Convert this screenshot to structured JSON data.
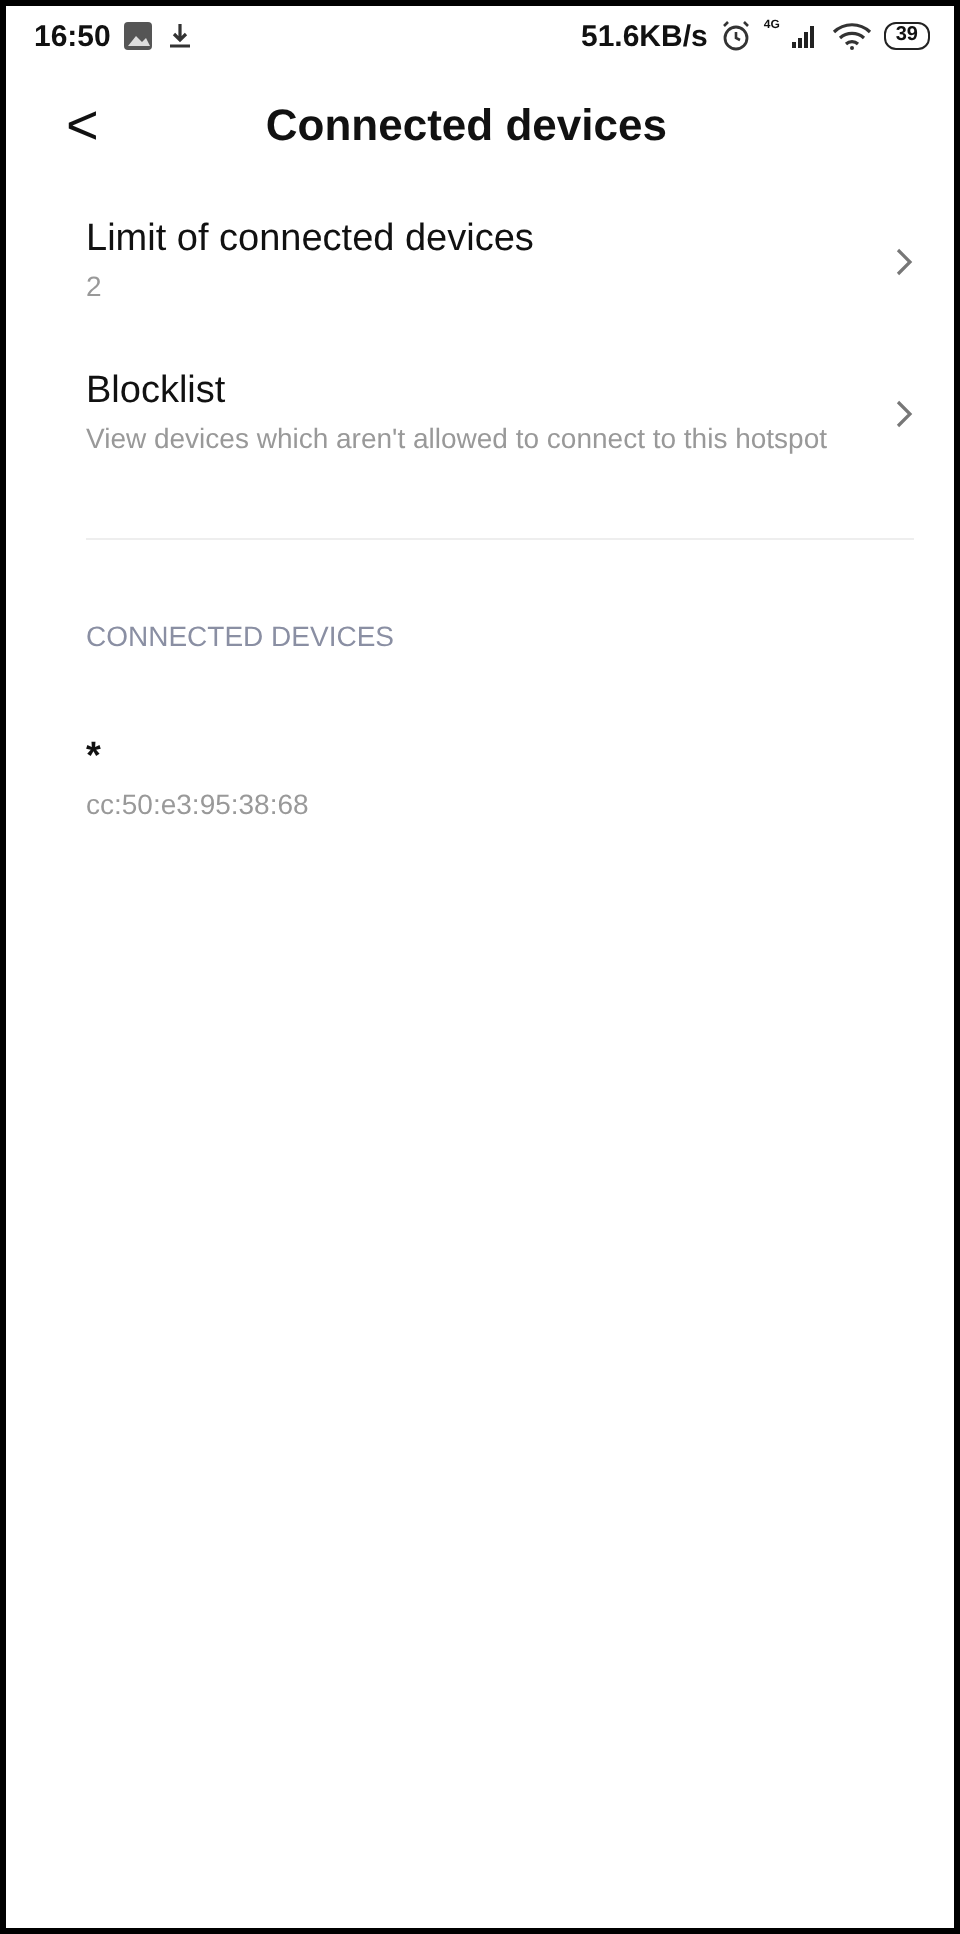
{
  "status_bar": {
    "time": "16:50",
    "speed": "51.6KB/s",
    "network": "4G",
    "battery": "39"
  },
  "header": {
    "back": "<",
    "title": "Connected devices"
  },
  "settings": [
    {
      "title": "Limit of connected devices",
      "subtitle": "2"
    },
    {
      "title": "Blocklist",
      "subtitle": "View devices which aren't allowed to connect to this hotspot"
    }
  ],
  "section": {
    "heading": "CONNECTED DEVICES",
    "devices": [
      {
        "name": "*",
        "address": "cc:50:e3:95:38:68"
      }
    ]
  }
}
